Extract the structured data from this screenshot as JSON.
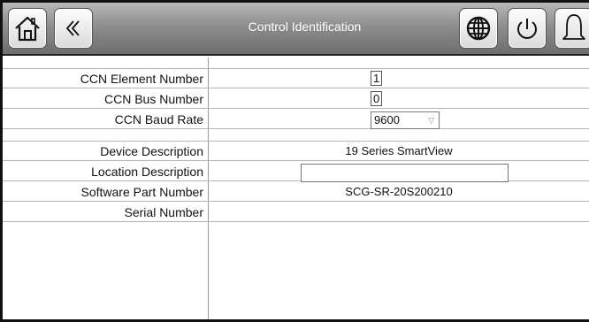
{
  "header": {
    "title": "Control Identification",
    "buttons": {
      "home": "home-icon",
      "back": "double-chevron-left-icon",
      "language": "globe-icon",
      "power": "power-icon",
      "alarm": "bell-icon"
    }
  },
  "form": {
    "ccn_element_number": {
      "label": "CCN Element Number",
      "value": "1"
    },
    "ccn_bus_number": {
      "label": "CCN Bus Number",
      "value": "0"
    },
    "ccn_baud_rate": {
      "label": "CCN Baud Rate",
      "value": "9600"
    },
    "device_description": {
      "label": "Device Description",
      "value": "19 Series SmartView"
    },
    "location_description": {
      "label": "Location Description",
      "value": ""
    },
    "software_part_number": {
      "label": "Software Part Number",
      "value": "SCG-SR-20S200210"
    },
    "serial_number": {
      "label": "Serial Number",
      "value": ""
    }
  },
  "colors": {
    "header_gradient_top": "#b8b8b8",
    "header_gradient_bottom": "#6e6e6e",
    "title_text": "#ffffff"
  }
}
